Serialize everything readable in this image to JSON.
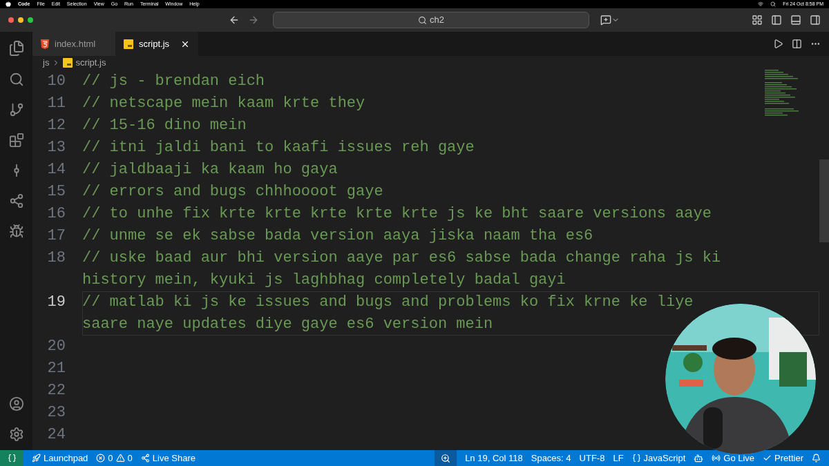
{
  "menu_bar": {
    "items": [
      "Code",
      "File",
      "Edit",
      "Selection",
      "View",
      "Go",
      "Run",
      "Terminal",
      "Window",
      "Help"
    ],
    "clock": "Fri 24 Oct  8:58 PM"
  },
  "title_bar": {
    "search": "ch2"
  },
  "tabs": [
    {
      "label": "index.html",
      "kind": "html",
      "selected": false
    },
    {
      "label": "script.js",
      "kind": "js",
      "selected": true
    }
  ],
  "breadcrumb": [
    {
      "label": "js",
      "kind": "folder"
    },
    {
      "label": "script.js",
      "kind": "js"
    }
  ],
  "code_lines": [
    {
      "number": "10",
      "rows": [
        "// js - brendan eich"
      ],
      "current": false
    },
    {
      "number": "11",
      "rows": [
        "// netscape mein kaam krte they"
      ],
      "current": false
    },
    {
      "number": "12",
      "rows": [
        "// 15-16 dino mein"
      ],
      "current": false
    },
    {
      "number": "13",
      "rows": [
        "// itni jaldi bani to kaafi issues reh gaye"
      ],
      "current": false
    },
    {
      "number": "14",
      "rows": [
        "// jaldbaaji ka kaam ho gaya"
      ],
      "current": false
    },
    {
      "number": "15",
      "rows": [
        "// errors and bugs chhhoooot gaye"
      ],
      "current": false
    },
    {
      "number": "16",
      "rows": [
        "// to unhe fix krte krte krte krte krte js ke bht saare versions aaye"
      ],
      "current": false
    },
    {
      "number": "17",
      "rows": [
        "// unme se ek sabse bada version aaya jiska naam tha es6"
      ],
      "current": false
    },
    {
      "number": "18",
      "rows": [
        "// uske baad aur bhi version aaye par es6 sabse bada change raha js ki",
        "history mein, kyuki js laghbhag completely badal gayi"
      ],
      "current": false
    },
    {
      "number": "19",
      "rows": [
        "// matlab ki js ke issues and bugs and problems ko fix krne ke liye",
        "saare naye updates diye gaye es6 version mein"
      ],
      "current": true
    },
    {
      "number": "20",
      "current": false
    },
    {
      "number": "21",
      "current": false
    },
    {
      "number": "22",
      "current": false
    },
    {
      "number": "23",
      "current": false
    },
    {
      "number": "24",
      "current": false
    }
  ],
  "status_bar": {
    "left": [
      {
        "kind": "launchpad",
        "label": "Launchpad"
      },
      {
        "kind": "problems",
        "errors": "0",
        "warnings": "0"
      },
      {
        "kind": "liveshare",
        "label": "Live Share"
      }
    ],
    "right": [
      {
        "kind": "text",
        "label": "Ln 19, Col 118"
      },
      {
        "kind": "text",
        "label": "Spaces: 4"
      },
      {
        "kind": "text",
        "label": "UTF-8"
      },
      {
        "kind": "text",
        "label": "LF"
      },
      {
        "kind": "language",
        "label": "JavaScript"
      },
      {
        "kind": "copilot"
      },
      {
        "kind": "golive",
        "label": "Go Live"
      },
      {
        "kind": "prettier",
        "label": "Prettier"
      }
    ]
  }
}
